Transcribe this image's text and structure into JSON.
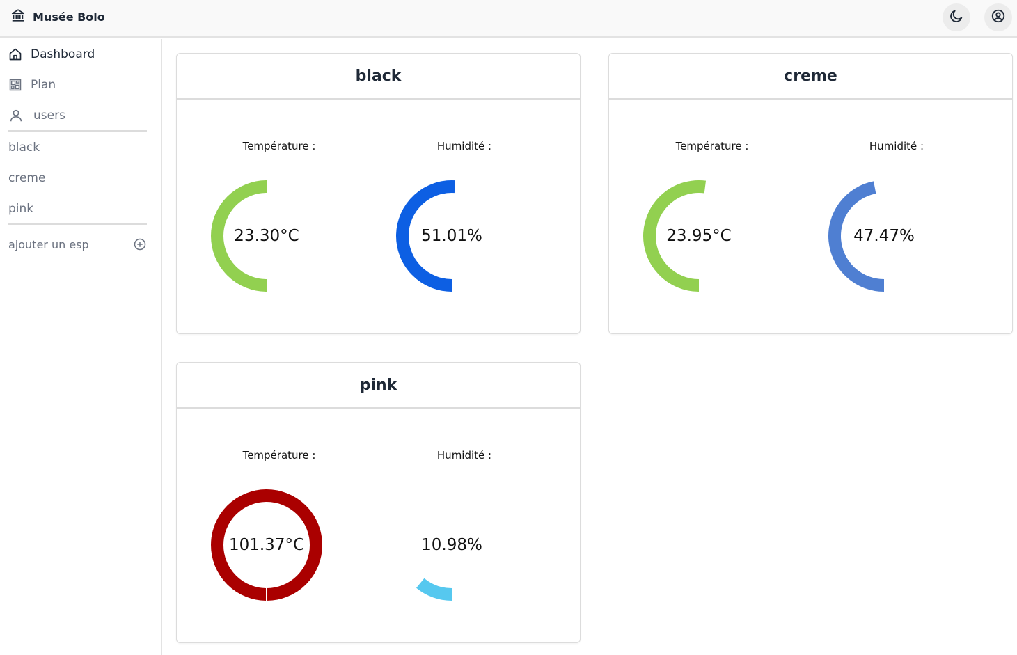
{
  "app": {
    "title": "Musée Bolo"
  },
  "header": {
    "theme_icon": "moon-icon",
    "account_icon": "user-circle-icon"
  },
  "sidebar": {
    "nav": [
      {
        "label": "Dashboard",
        "icon": "home-icon"
      },
      {
        "label": "Plan",
        "icon": "floor-plan-icon"
      },
      {
        "label": "users",
        "icon": "user-icon"
      }
    ],
    "esps": [
      "black",
      "creme",
      "pink"
    ],
    "add_label": "ajouter un esp",
    "add_icon": "plus-circle-icon"
  },
  "cards": [
    {
      "name": "black",
      "temperature": {
        "label": "Température :",
        "value": "23.30°C",
        "percent": 0.5,
        "color": "#92d050"
      },
      "humidity": {
        "label": "Humidité :",
        "value": "51.01%",
        "percent": 0.51,
        "color": "#0d5fe3"
      }
    },
    {
      "name": "creme",
      "temperature": {
        "label": "Température :",
        "value": "23.95°C",
        "percent": 0.52,
        "color": "#92d050"
      },
      "humidity": {
        "label": "Humidité :",
        "value": "47.47%",
        "percent": 0.47,
        "color": "#4f7fd2"
      }
    },
    {
      "name": "pink",
      "temperature": {
        "label": "Température :",
        "value": "101.37°C",
        "percent": 1.0,
        "color": "#aa0000"
      },
      "humidity": {
        "label": "Humidité :",
        "value": "10.98%",
        "percent": 0.11,
        "color": "#56c8ef"
      }
    }
  ]
}
